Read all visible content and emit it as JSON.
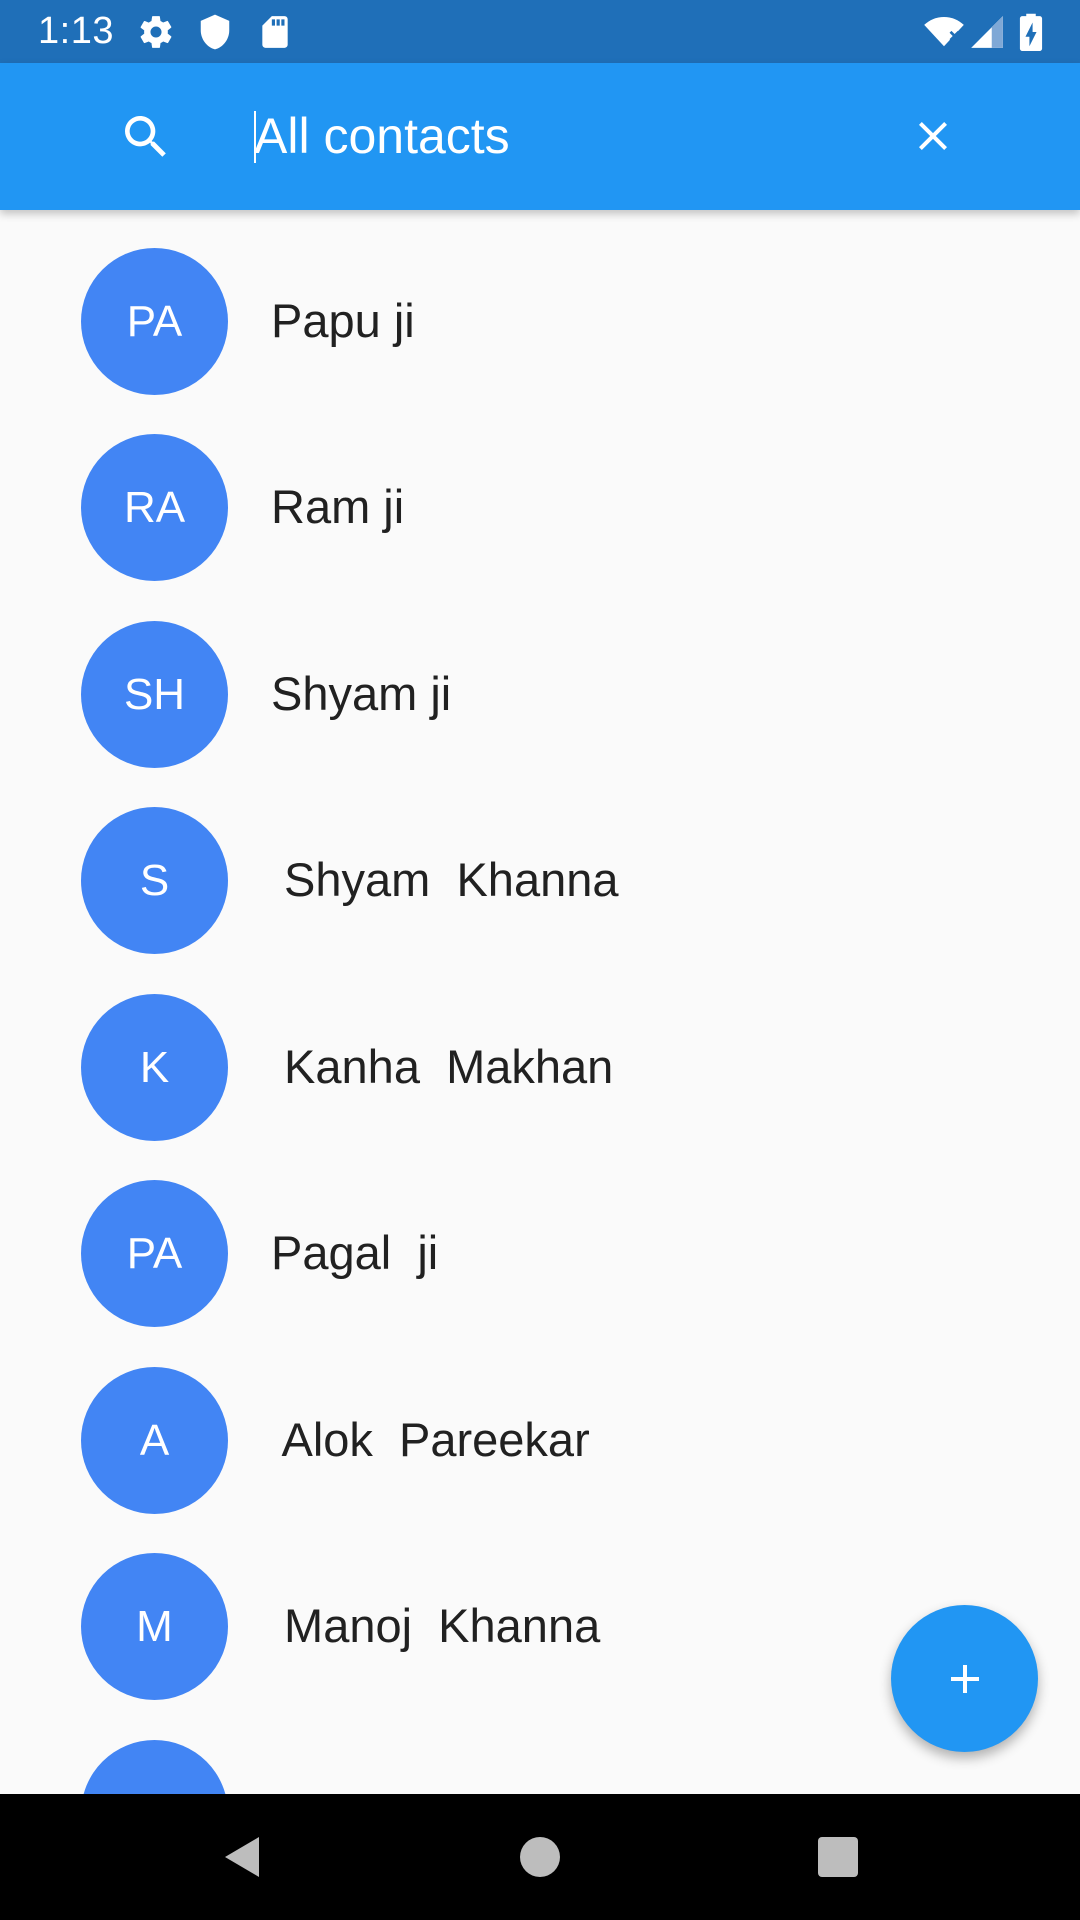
{
  "status_bar": {
    "time": "1:13",
    "icons": [
      "gear-icon",
      "shield-icon",
      "sd-card-icon",
      "wifi-icon",
      "signal-icon",
      "battery-charging-icon"
    ]
  },
  "app_bar": {
    "search_placeholder": "All contacts",
    "search_icon": "search-icon",
    "close_icon": "close-icon",
    "background_color": "#2196f3"
  },
  "contacts": [
    {
      "initials": "PA",
      "name": "Papu ji"
    },
    {
      "initials": "RA",
      "name": "Ram ji"
    },
    {
      "initials": "SH",
      "name": "Shyam ji"
    },
    {
      "initials": "S",
      "name": " Shyam  Khanna"
    },
    {
      "initials": "K",
      "name": " Kanha  Makhan"
    },
    {
      "initials": "PA",
      "name": "Pagal  ji"
    },
    {
      "initials": "A",
      "name": " Alok  Pareekar"
    },
    {
      "initials": "M",
      "name": " Manoj  Khanna"
    },
    {
      "initials": "",
      "name": ""
    }
  ],
  "avatar_color": "#4285f4",
  "fab": {
    "icon": "plus-icon",
    "color": "#2196f3"
  },
  "nav_bar": {
    "icons": [
      "back-icon",
      "home-icon",
      "recents-icon"
    ]
  }
}
